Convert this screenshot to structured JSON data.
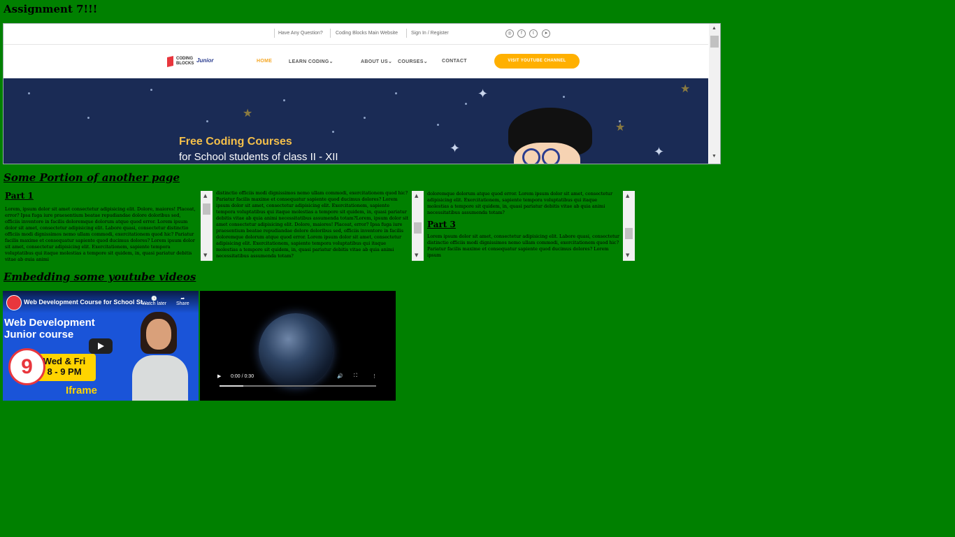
{
  "page": {
    "title": "Assignment 7!!!",
    "section_portion": "Some Portion of another page",
    "section_videos": "Embedding some youtube videos"
  },
  "embed_site": {
    "topbar": {
      "links": [
        "Have Any Question?",
        "Coding Blocks Main Website",
        "Sign In / Register"
      ],
      "social_icons": [
        "instagram-icon",
        "facebook-icon",
        "twitter-icon",
        "telegram-icon"
      ]
    },
    "logo": {
      "line1": "CODING",
      "line2": "BLOCKS",
      "suffix": "Junior"
    },
    "nav": [
      "HOME",
      "LEARN CODING",
      "ABOUT US",
      "COURSES",
      "CONTACT"
    ],
    "cta": "VISIT YOUTUBE CHANNEL",
    "hero": {
      "line1": "Free Coding Courses",
      "line2": "for School students of class II - XII"
    },
    "colors": {
      "accent": "#f5a623",
      "cta": "#ffb000",
      "hero_bg": "#1a2b55"
    }
  },
  "mini_frames": [
    {
      "heading": "Part 1",
      "text": "Lorem, ipsum dolor sit amet consectetur adipisicing elit. Dolore, maiores! Placeat, error? Ipsa fuga iure praesentium beatae repudiandae dolore doloribus sed, officiis inventore in facilis doloremque dolorum atque quod error. Lorem ipsum dolor sit amet, consectetur adipisicing elit. Labore quasi, consectetur distinctio officiis modi dignissimos nemo ullam commodi, exercitationem quod hic? Pariatur facilis maxime et consequatur sapiente quod ducimus dolores? Lorem ipsum dolor sit amet, consectetur adipisicing elit. Exercitationem, sapiente tempora voluptatibus qui itaque molestias a tempore sit quidem, in, quasi pariatur debitis vitae ab quia animi"
    },
    {
      "text": "distinctio officiis modi dignissimos nemo ullam commodi, exercitationem quod hic? Pariatur facilis maxime et consequatur sapiente quod ducimus dolores? Lorem ipsum dolor sit amet, consectetur adipisicing elit. Exercitationem, sapiente tempora voluptatibus qui itaque molestias a tempore sit quidem, in, quasi pariatur debitis vitae ab quia animi necessitatibus assumenda totam?Lorem, ipsum dolor sit amet consectetur adipisicing elit. Dolore, maiores! Placeat, error? Ipsa fuga iure praesentium beatae repudiandae dolore doloribus sed, officiis inventore in facilis doloremque dolorum atque quod error. Lorem ipsum dolor sit amet, consectetur adipisicing elit. Exercitationem, sapiente tempora voluptatibus qui itaque molestias a tempore sit quidem, in, quasi pariatur debitis vitae ab quia animi necessitatibus assumenda totam?"
    },
    {
      "text_before": "doloremque dolorum atque quod error. Lorem ipsum dolor sit amet, consectetur adipisicing elit. Exercitationem, sapiente tempora voluptatibus qui itaque molestias a tempore sit quidem, in, quasi pariatur debitis vitae ab quia animi necessitatibus assumenda totam?",
      "heading": "Part 3",
      "text": "Lorem ipsum dolor sit amet, consectetur adipisicing elit. Labore quasi, consectetur distinctio officiis modi dignissimos nemo ullam commodi, exercitationem quod hic? Pariatur facilis maxime et consequatur sapiente quod ducimus dolores? Lorem ipsum"
    }
  ],
  "youtube": {
    "title": "Web Development Course for School St...",
    "watch_later": "Watch later",
    "share": "Share",
    "thumb_line1": "Web Development",
    "thumb_line2": "Junior course",
    "badge_number": "9",
    "schedule_line1": "Wed & Fri",
    "schedule_line2": "8 - 9 PM",
    "label": "Iframe"
  },
  "video": {
    "time": "0:00 / 0:30",
    "progress": 0.15
  }
}
